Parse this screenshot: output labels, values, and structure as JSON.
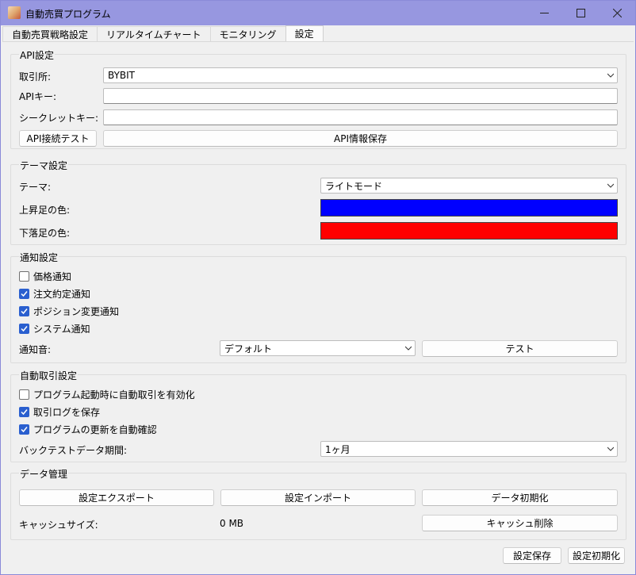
{
  "window": {
    "title": "自動売買プログラム"
  },
  "tabs": [
    "自動売買戦略設定",
    "リアルタイムチャート",
    "モニタリング",
    "設定"
  ],
  "api": {
    "title": "API設定",
    "exchange_label": "取引所:",
    "exchange_value": "BYBIT",
    "key_label": "APIキー:",
    "key_value": "",
    "secret_label": "シークレットキー:",
    "secret_value": "",
    "test_button": "API接続テスト",
    "save_button": "API情報保存"
  },
  "theme": {
    "title": "テーマ設定",
    "theme_label": "テーマ:",
    "theme_value": "ライトモード",
    "up_label": "上昇足の色:",
    "up_color": "#0000ff",
    "down_label": "下落足の色:",
    "down_color": "#ff0000"
  },
  "notify": {
    "title": "通知設定",
    "options": [
      {
        "label": "価格通知",
        "checked": false
      },
      {
        "label": "注文約定通知",
        "checked": true
      },
      {
        "label": "ポジション変更通知",
        "checked": true
      },
      {
        "label": "システム通知",
        "checked": true
      }
    ],
    "sound_label": "通知音:",
    "sound_value": "デフォルト",
    "test_button": "テスト"
  },
  "auto": {
    "title": "自動取引設定",
    "options": [
      {
        "label": "プログラム起動時に自動取引を有効化",
        "checked": false
      },
      {
        "label": "取引ログを保存",
        "checked": true
      },
      {
        "label": "プログラムの更新を自動確認",
        "checked": true
      }
    ],
    "period_label": "バックテストデータ期間:",
    "period_value": "1ヶ月"
  },
  "data": {
    "title": "データ管理",
    "export_button": "設定エクスポート",
    "import_button": "設定インポート",
    "init_button": "データ初期化",
    "cache_label": "キャッシュサイズ:",
    "cache_value": "0 MB",
    "cache_button": "キャッシュ削除"
  },
  "footer": {
    "save_button": "設定保存",
    "reset_button": "設定初期化"
  },
  "colors": {
    "titlebar": "#9797e0",
    "accent": "#2a5fcf"
  }
}
